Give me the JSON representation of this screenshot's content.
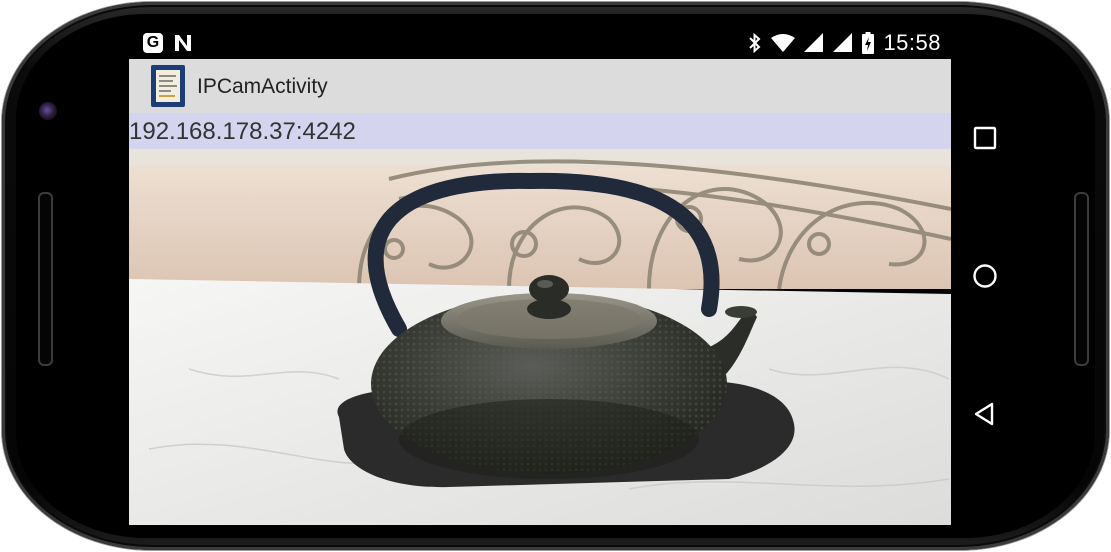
{
  "status_bar": {
    "left_icons": [
      "google-g-icon",
      "n-icon"
    ],
    "right_icons": [
      "bluetooth-icon",
      "wifi-icon",
      "signal-icon",
      "signal-icon",
      "battery-icon"
    ],
    "g_letter": "G",
    "time": "15:58"
  },
  "app_bar": {
    "title": "IPCamActivity",
    "icon": "app-notepad-icon"
  },
  "address": {
    "text": "192.168.178.37:4242"
  },
  "camera": {
    "subject": "cast iron teapot on slate coaster"
  },
  "nav_bar": {
    "buttons": [
      "recents-square-icon",
      "home-circle-icon",
      "back-triangle-icon"
    ]
  },
  "colors": {
    "app_bar_bg": "#dcdcdc",
    "address_bg": "#d4d4ee",
    "status_bg": "#000000"
  }
}
